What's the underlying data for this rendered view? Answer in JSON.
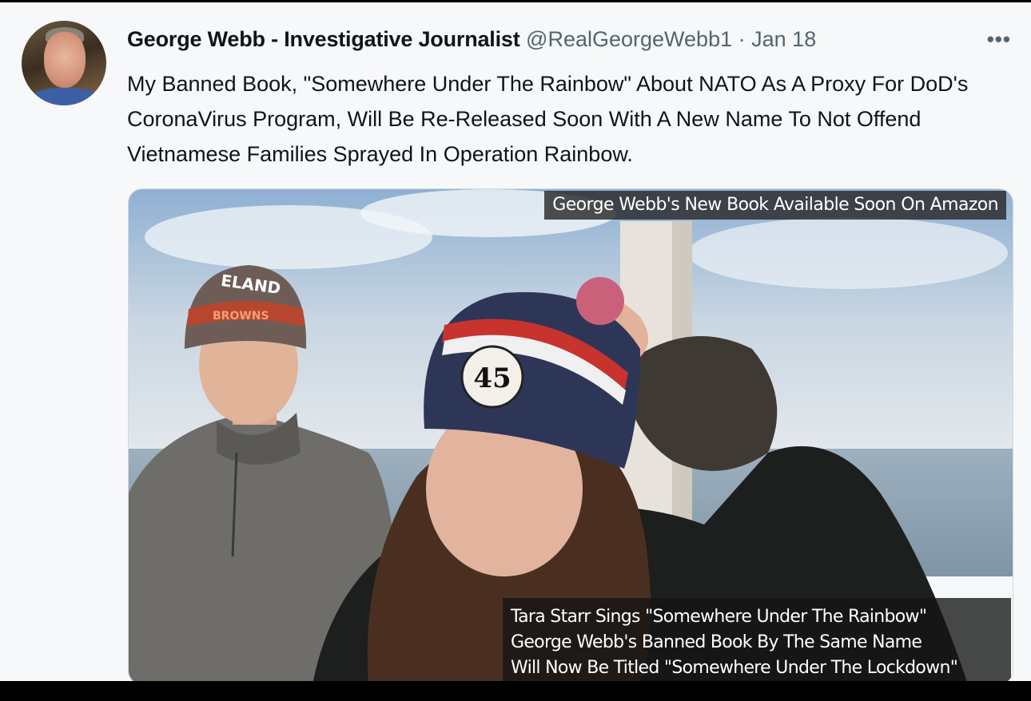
{
  "tweet": {
    "author_name": "George Webb - Investigative Journalist",
    "handle": "@RealGeorgeWebb1",
    "separator": "·",
    "date": "Jan 18",
    "more_label": "•••",
    "text": "My Banned Book, \"Somewhere Under The Rainbow\" About NATO As A Proxy For DoD's CoronaVirus Program, Will Be Re-Released Soon With A New Name To Not Offend Vietnamese Families Sprayed In Operation Rainbow."
  },
  "media": {
    "caption_top": "George Webb's New Book Available Soon On Amazon",
    "caption_lines": [
      "Tara Starr Sings \"Somewhere Under The Rainbow\"",
      "George Webb's Banned Book By The Same Name",
      "Will Now Be Titled \"Somewhere Under The Lockdown\""
    ],
    "man_hat_text_top": "ELAND",
    "man_hat_text_band": "BROWNS",
    "woman_hat_badge": "45"
  },
  "icons": {
    "avatar": "avatar-photo",
    "more": "more-icon"
  }
}
